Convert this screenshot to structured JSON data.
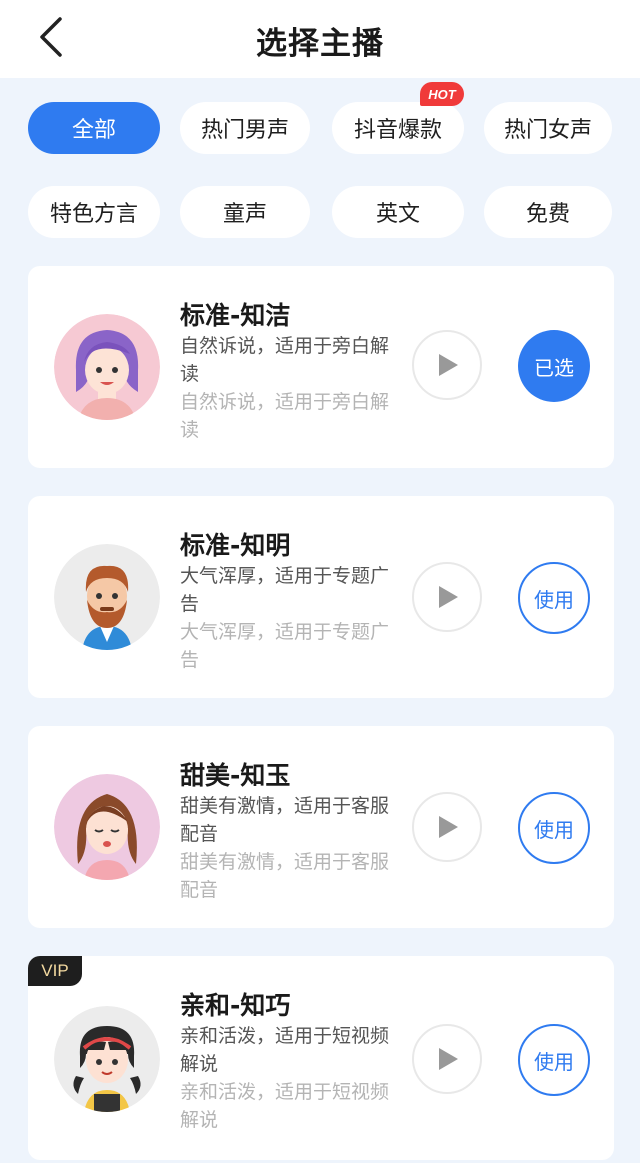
{
  "header": {
    "title": "选择主播"
  },
  "filters": [
    {
      "label": "全部",
      "active": true
    },
    {
      "label": "热门男声",
      "active": false
    },
    {
      "label": "抖音爆款",
      "active": false,
      "badge": "HOT"
    },
    {
      "label": "热门女声",
      "active": false
    },
    {
      "label": "特色方言",
      "active": false
    },
    {
      "label": "童声",
      "active": false
    },
    {
      "label": "英文",
      "active": false
    },
    {
      "label": "免费",
      "active": false
    }
  ],
  "voices": [
    {
      "name": "标准-知洁",
      "desc": "自然诉说，适用于旁白解读",
      "button": "已选",
      "selected": true,
      "vip": false
    },
    {
      "name": "标准-知明",
      "desc": "大气浑厚，适用于专题广告",
      "button": "使用",
      "selected": false,
      "vip": false
    },
    {
      "name": "甜美-知玉",
      "desc": "甜美有激情，适用于客服配音",
      "button": "使用",
      "selected": false,
      "vip": false
    },
    {
      "name": "亲和-知巧",
      "desc": "亲和活泼，适用于短视频解说",
      "button": "使用",
      "selected": false,
      "vip": true,
      "badge": "VIP"
    }
  ],
  "colors": {
    "accent": "#2f7bf0",
    "background": "#eef4fc",
    "hot": "#f03a3a"
  }
}
